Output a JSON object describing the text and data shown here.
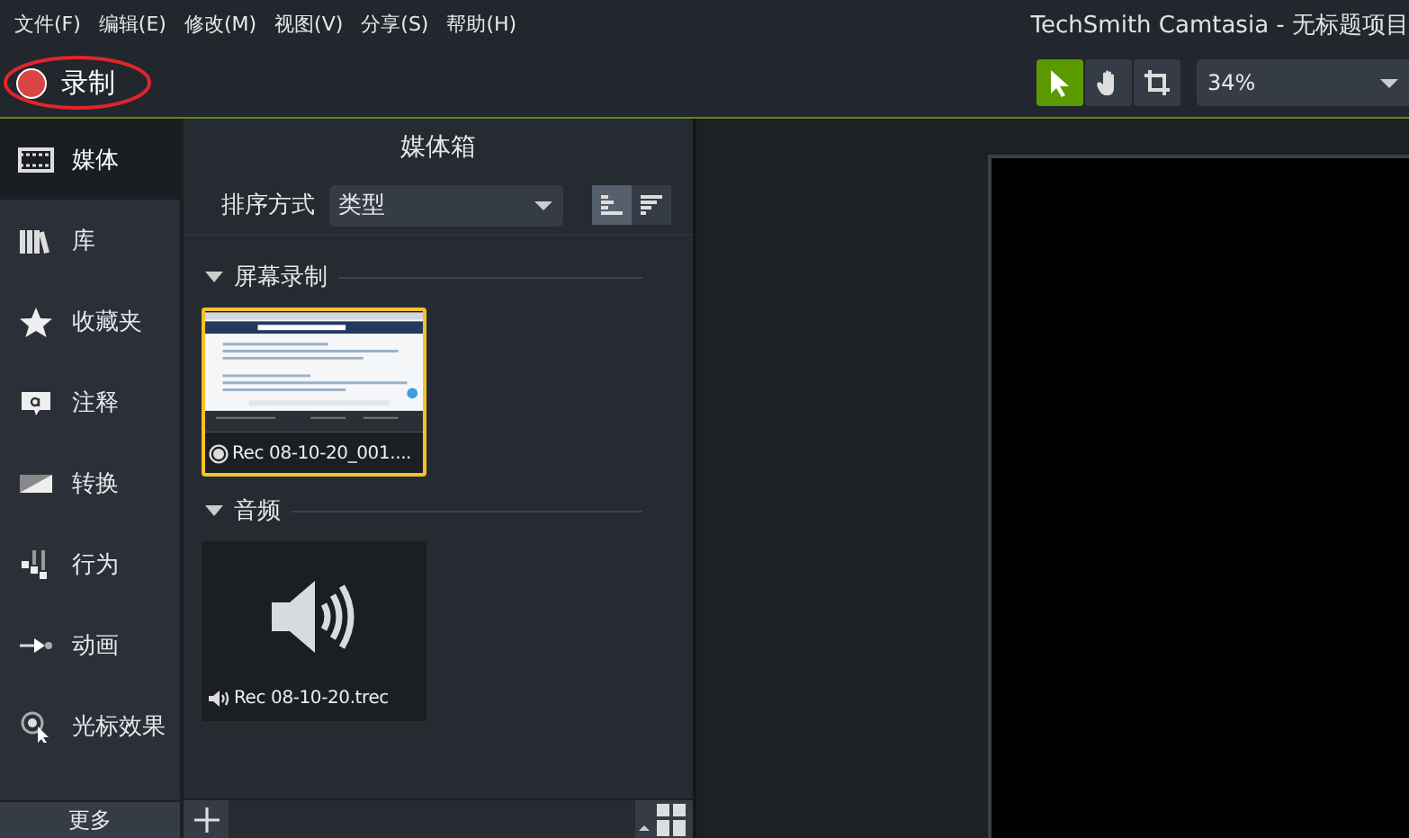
{
  "window": {
    "title": "TechSmith Camtasia - 无标题项目"
  },
  "menu": [
    "文件(F)",
    "编辑(E)",
    "修改(M)",
    "视图(V)",
    "分享(S)",
    "帮助(H)"
  ],
  "record_button": {
    "label": "录制",
    "circled": true
  },
  "tools": [
    {
      "kind": "select",
      "selected": true
    },
    {
      "kind": "pan",
      "selected": false
    },
    {
      "kind": "crop",
      "selected": false
    }
  ],
  "zoom": {
    "value": "34%"
  },
  "sidebar": {
    "items": [
      {
        "kind": "media",
        "label": "媒体",
        "selected": true
      },
      {
        "kind": "library",
        "label": "库",
        "selected": false
      },
      {
        "kind": "favorites",
        "label": "收藏夹",
        "selected": false
      },
      {
        "kind": "annotations",
        "label": "注释",
        "selected": false
      },
      {
        "kind": "transitions",
        "label": "转换",
        "selected": false
      },
      {
        "kind": "behaviors",
        "label": "行为",
        "selected": false
      },
      {
        "kind": "animations",
        "label": "动画",
        "selected": false
      },
      {
        "kind": "cursor",
        "label": "光标效果",
        "selected": false
      }
    ],
    "more": "更多"
  },
  "media_bin": {
    "title": "媒体箱",
    "sort_label": "排序方式",
    "sort_value": "类型",
    "view_modes": [
      {
        "kind": "align-left",
        "selected": true
      },
      {
        "kind": "align-right",
        "selected": false
      }
    ],
    "groups": [
      {
        "name": "屏幕录制",
        "expanded": true,
        "items": [
          {
            "kind": "video",
            "name": "Rec 08-10-20_001....",
            "selected": true
          }
        ]
      },
      {
        "name": "音频",
        "expanded": true,
        "items": [
          {
            "kind": "audio",
            "name": "Rec 08-10-20.trec",
            "selected": false
          }
        ]
      }
    ]
  }
}
